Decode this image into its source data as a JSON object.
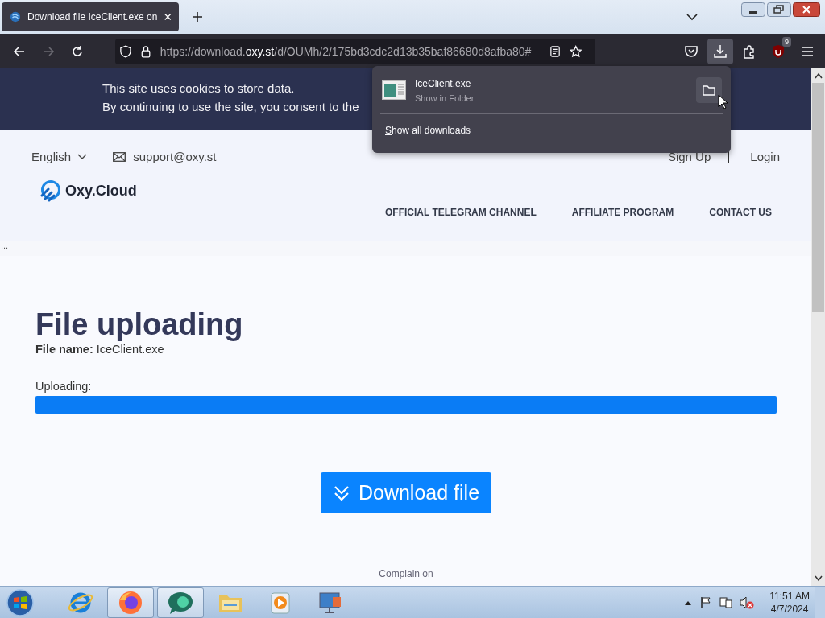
{
  "browser": {
    "tab": {
      "title": "Download file IceClient.exe on",
      "selected": true
    },
    "nav_buttons": [
      {
        "kind": "back",
        "disabled": false
      },
      {
        "kind": "forward",
        "disabled": true
      },
      {
        "kind": "reload",
        "disabled": false
      }
    ],
    "address_bar": {
      "url_parts": [
        {
          "text": "https://download.",
          "highlight": false
        },
        {
          "text": "oxy.st",
          "highlight": true
        },
        {
          "text": "/d/OUMh/2/175bd3cdc2d13b35baf86680d8afba80#",
          "highlight": false
        }
      ]
    },
    "toolbar_buttons": [
      {
        "kind": "pocket",
        "active": false
      },
      {
        "kind": "downloads",
        "active": true
      },
      {
        "kind": "extensions",
        "active": false
      },
      {
        "kind": "ublock",
        "active": false,
        "badge": "9"
      },
      {
        "kind": "menu",
        "active": false
      }
    ],
    "downloads_panel": {
      "items": [
        {
          "name": "IceClient.exe",
          "action": "Show in Folder"
        }
      ],
      "footer": "Show all downloads"
    }
  },
  "page": {
    "cookie_banner": [
      "This site uses cookies to store data.",
      "By continuing to use the site, you consent to the"
    ],
    "language": "English",
    "email": "support@oxy.st",
    "auth_links": [
      "Sign Up",
      "Login"
    ],
    "logo": "Oxy.Cloud",
    "nav": [
      "OFFICIAL TELEGRAM CHANNEL",
      "AFFILIATE PROGRAM",
      "CONTACT US"
    ],
    "ellipsis": "...",
    "title": "File uploading",
    "file_line": "**File name:** IceClient.exe",
    "progress": {
      "label": "Uploading:",
      "level": 1
    },
    "download_button": "Download file",
    "footer_text": "Complain on"
  },
  "taskbar": {
    "apps": [
      {
        "kind": "ie",
        "active": false
      },
      {
        "kind": "firefox",
        "active": true
      },
      {
        "kind": "chat",
        "active": true
      },
      {
        "kind": "explorer",
        "active": false
      },
      {
        "kind": "media",
        "active": false
      },
      {
        "kind": "network",
        "active": false
      }
    ],
    "clock": {
      "time": "11:51 AM",
      "date": "4/7/2024"
    }
  }
}
